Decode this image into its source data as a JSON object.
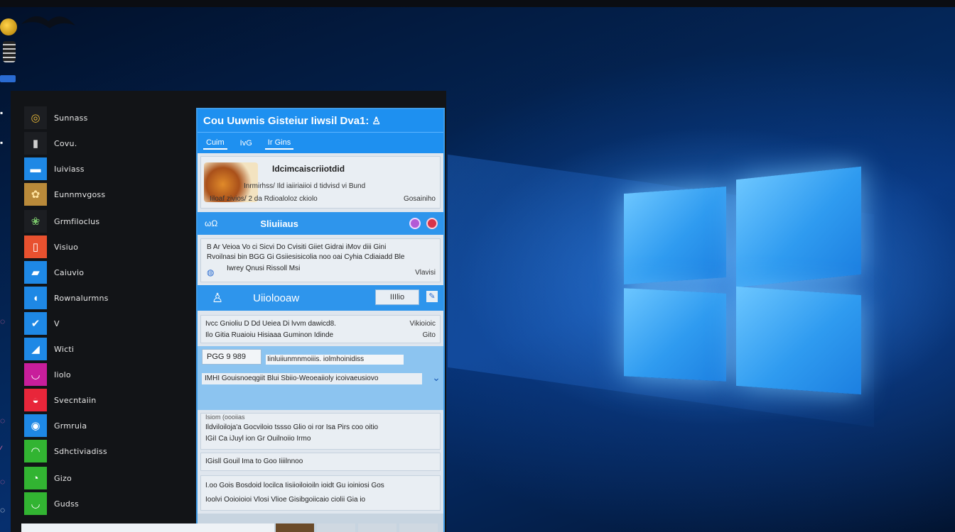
{
  "start_menu": {
    "apps": [
      {
        "label": "Sunnass",
        "tile_color": "#1c1e22",
        "glyph": "◎",
        "glyph_color": "#e7b83a"
      },
      {
        "label": "Covu.",
        "tile_color": "#1c1e22",
        "glyph": "▮",
        "glyph_color": "#cfcfcf"
      },
      {
        "label": "Iuiviass",
        "tile_color": "#1e88e5",
        "glyph": "▬",
        "glyph_color": "#ffffff"
      },
      {
        "label": "Eunnmvgoss",
        "tile_color": "#b98a3a",
        "glyph": "✿",
        "glyph_color": "#ffe3a0"
      },
      {
        "label": "Grmfiloclus",
        "tile_color": "#1c1e22",
        "glyph": "❀",
        "glyph_color": "#7bc86c"
      },
      {
        "label": "Visiuo",
        "tile_color": "#e8512f",
        "glyph": "▯",
        "glyph_color": "#ffffff"
      },
      {
        "label": "Caiuvio",
        "tile_color": "#1e88e5",
        "glyph": "▰",
        "glyph_color": "#ffffff"
      },
      {
        "label": "Rownalurmns",
        "tile_color": "#1e88e5",
        "glyph": "◖",
        "glyph_color": "#ffffff"
      },
      {
        "label": "V",
        "tile_color": "#1e88e5",
        "glyph": "✔",
        "glyph_color": "#ffffff"
      },
      {
        "label": "Wicti",
        "tile_color": "#1e88e5",
        "glyph": "◢",
        "glyph_color": "#ffffff"
      },
      {
        "label": "Iiolo",
        "tile_color": "#c81e9b",
        "glyph": "◡",
        "glyph_color": "#ffffff"
      },
      {
        "label": "Svecntaiin",
        "tile_color": "#e8263a",
        "glyph": "◒",
        "glyph_color": "#ffffff"
      },
      {
        "label": "Grmruia",
        "tile_color": "#1e88e5",
        "glyph": "◉",
        "glyph_color": "#ffffff"
      },
      {
        "label": "Sdhctiviadiss",
        "tile_color": "#32b432",
        "glyph": "◠",
        "glyph_color": "#ffffff"
      },
      {
        "label": "Gizo",
        "tile_color": "#32b432",
        "glyph": "◔",
        "glyph_color": "#ffffff"
      },
      {
        "label": "Gudss",
        "tile_color": "#32b432",
        "glyph": "◡",
        "glyph_color": "#ffffff"
      }
    ]
  },
  "window": {
    "title": "Cou Uuwnis Gisteiur Iiwsil Dva1:",
    "user_icon": "user-icon",
    "tabs": [
      "Cuim",
      "IvG",
      "Ir Gins"
    ],
    "news": {
      "title": "Idcimcaiscriiotdid",
      "line": "Inrmirhss/ Ild iaiiriaiioi d tidvisd vi Bund",
      "meta": "Iiloaf zivios/ 2 da Rdioaloloz ckiolo",
      "source": "Gosainiho"
    },
    "section1": {
      "icon_label": "ωΩ",
      "title": "Sliuiiaus"
    },
    "notifications": {
      "line1": "B Ar Veioa Vo ci Sicvi Do Cvisiti Giiet Gidrai iMov diii Gini",
      "line2": "Rvoilnasi bin BGG Gi Gsiiesisicolia noo oai Cyhia Cdiaiadd Ble",
      "line3": "Iwrey Qnusi Rissoll Msi",
      "side": "Vlavisi"
    },
    "section2": {
      "title": "Uiiolooaw",
      "input_value": "IIIlio"
    },
    "messages": {
      "line1": "Ivcc Gnioliu D Dd Ueiea Di lvvm dawicd8.",
      "line2": "Ilo Gitia Ruaioiu Hisiaaa Guminon Idinde",
      "side1": "Vikioioic",
      "side2": "Gito"
    },
    "form": {
      "code_value": "PGG 9 989",
      "search_value": "Iinluiiunmnmoiiis. iolmhoinidiss",
      "long_value": "IMHI Gouisnoeqgiit Blui Sbiio-Weoeaiioly icoivaeusiovo"
    },
    "list": {
      "head": "Isiom (oooiias",
      "item1": "Ildviloiloja'a Gocviloio tssso Glio oi ror Isa Pirs coo oitio",
      "item2": "IGiI Ca iJuyl ion Gr Ouilnoiio Irmo",
      "item3": "IGisll Gouil Ima to Goo Iiiilnnoo",
      "item4a": "I.oo Gois Bosdoid locilca Iisiioiloioiln ioidt Gu ioiniosi Gos",
      "item4b": "Ioolvi Ooioioioi Vlosi Vlioe Gisibgoiicaio ciolii Gia io"
    }
  },
  "colors": {
    "accent": "#1e90f0",
    "start_bg": "#121417",
    "window_bg": "#dfe6ee"
  }
}
